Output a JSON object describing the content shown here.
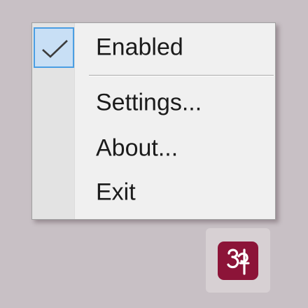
{
  "context_menu": {
    "items": [
      {
        "label": "Enabled",
        "checked": true
      },
      {
        "label": "Settings..."
      },
      {
        "label": "About..."
      },
      {
        "label": "Exit"
      }
    ]
  },
  "tray": {
    "app_icon": "maroon-glyph-app-icon"
  },
  "colors": {
    "desktop": "#c8c0c5",
    "menu_background": "#f0f0f0",
    "check_highlight": "#c8dff5",
    "check_border": "#4a9ee3",
    "app_icon": "#8c1438"
  }
}
